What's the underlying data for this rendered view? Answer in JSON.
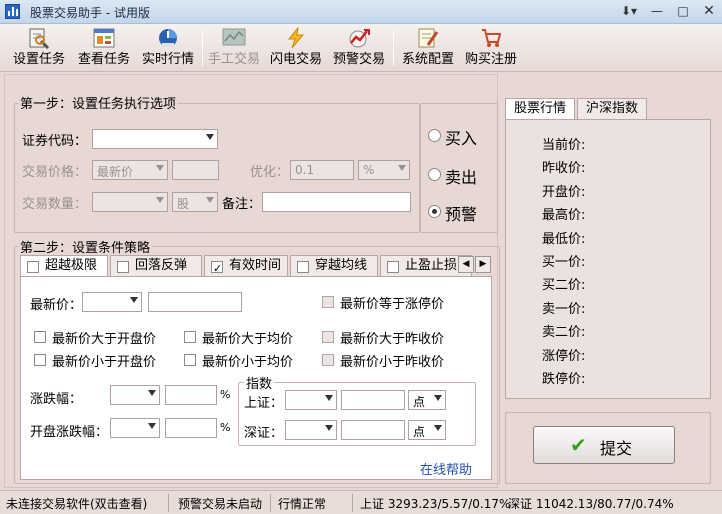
{
  "window": {
    "title": "股票交易助手 - 试用版"
  },
  "toolbar": {
    "items": [
      {
        "label": "设置任务",
        "icon": "settings-task-icon"
      },
      {
        "label": "查看任务",
        "icon": "view-task-icon"
      },
      {
        "label": "实时行情",
        "icon": "realtime-quote-icon"
      },
      {
        "label": "手工交易",
        "icon": "manual-trade-icon"
      },
      {
        "label": "闪电交易",
        "icon": "lightning-trade-icon"
      },
      {
        "label": "预警交易",
        "icon": "alert-trade-icon"
      },
      {
        "label": "系统配置",
        "icon": "system-config-icon"
      },
      {
        "label": "购买注册",
        "icon": "purchase-register-icon"
      }
    ]
  },
  "step1": {
    "title": "第一步：设置任务执行选项",
    "code_label": "证券代码：",
    "price_label": "交易价格：",
    "price_type": "最新价",
    "optimize_label": "优化：",
    "optimize_value": "0.1",
    "optimize_unit": "%",
    "qty_label": "交易数量：",
    "qty_unit": "股",
    "note_label": "备注：",
    "actions": [
      "买入",
      "卖出",
      "预警"
    ],
    "selected_action": "预警"
  },
  "step2": {
    "title": "第二步：设置条件策略",
    "tabs": [
      {
        "label": "超越极限",
        "checked": false
      },
      {
        "label": "回落反弹",
        "checked": false
      },
      {
        "label": "有效时间",
        "checked": true
      },
      {
        "label": "穿越均线",
        "checked": false
      },
      {
        "label": "止盈止损",
        "checked": false
      }
    ],
    "latest_price_label": "最新价：",
    "limit_up_label": "最新价等于涨停价",
    "conditions": [
      "最新价大于开盘价",
      "最新价大于均价",
      "最新价大于昨收价",
      "最新价小于开盘价",
      "最新价小于均价",
      "最新价小于昨收价"
    ],
    "change_label": "涨跌幅：",
    "open_change_label": "开盘涨跌幅：",
    "percent": "%",
    "index_group": "指数",
    "sh_label": "上证：",
    "sz_label": "深证：",
    "point_unit": "点",
    "help_link": "在线帮助"
  },
  "quote_panel": {
    "tabs": [
      "股票行情",
      "沪深指数"
    ],
    "fields": [
      "当前价:",
      "昨收价:",
      "开盘价:",
      "最高价:",
      "最低价:",
      "买一价:",
      "买二价:",
      "卖一价:",
      "卖二价:",
      "涨停价:",
      "跌停价:"
    ]
  },
  "submit_label": "提交",
  "status": {
    "conn": "未连接交易软件(双击查看)",
    "alert": "预警交易未启动",
    "market": "行情正常",
    "sh": "上证 3293.23/5.57/0.17%",
    "sz": "深证 11042.13/80.77/0.74%"
  }
}
